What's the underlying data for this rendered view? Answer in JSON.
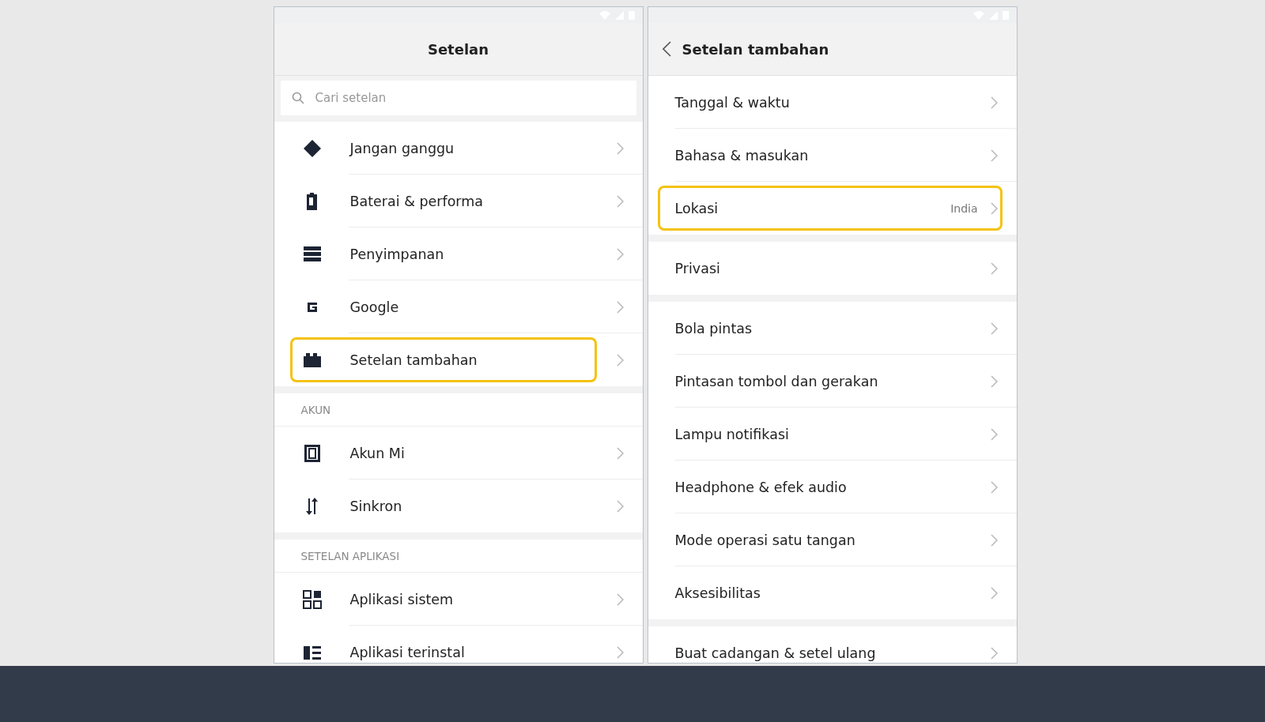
{
  "screens": [
    {
      "title": "Setelan",
      "back": false,
      "search": {
        "placeholder": "Cari setelan"
      },
      "groups": [
        {
          "items": [
            {
              "label": "Jangan ganggu",
              "highlighted": false
            },
            {
              "label": "Baterai & performa",
              "highlighted": false
            },
            {
              "label": "Penyimpanan",
              "highlighted": false
            },
            {
              "label": "Google",
              "highlighted": false
            },
            {
              "label": "Setelan tambahan",
              "highlighted": true
            }
          ]
        },
        {
          "header": "AKUN",
          "items": [
            {
              "label": "Akun Mi",
              "highlighted": false
            },
            {
              "label": "Sinkron",
              "highlighted": false
            }
          ]
        },
        {
          "header": "SETELAN APLIKASI",
          "items": [
            {
              "label": "Aplikasi sistem",
              "highlighted": false
            },
            {
              "label": "Aplikasi terinstal",
              "highlighted": false
            }
          ]
        }
      ]
    },
    {
      "title": "Setelan tambahan",
      "back": true,
      "groups": [
        {
          "items": [
            {
              "label": "Tanggal & waktu",
              "highlighted": false
            },
            {
              "label": "Bahasa & masukan",
              "highlighted": false
            },
            {
              "label": "Lokasi",
              "value": "India",
              "highlighted": true
            }
          ]
        },
        {
          "items": [
            {
              "label": "Privasi",
              "highlighted": false
            }
          ]
        },
        {
          "items": [
            {
              "label": "Bola pintas",
              "highlighted": false
            },
            {
              "label": "Pintasan tombol dan gerakan",
              "highlighted": false
            },
            {
              "label": "Lampu notifikasi",
              "highlighted": false
            },
            {
              "label": "Headphone & efek audio",
              "highlighted": false
            },
            {
              "label": "Mode operasi satu tangan",
              "highlighted": false
            },
            {
              "label": "Aksesibilitas",
              "highlighted": false
            }
          ]
        },
        {
          "items": [
            {
              "label": "Buat cadangan & setel ulang",
              "highlighted": false
            }
          ]
        }
      ]
    }
  ]
}
